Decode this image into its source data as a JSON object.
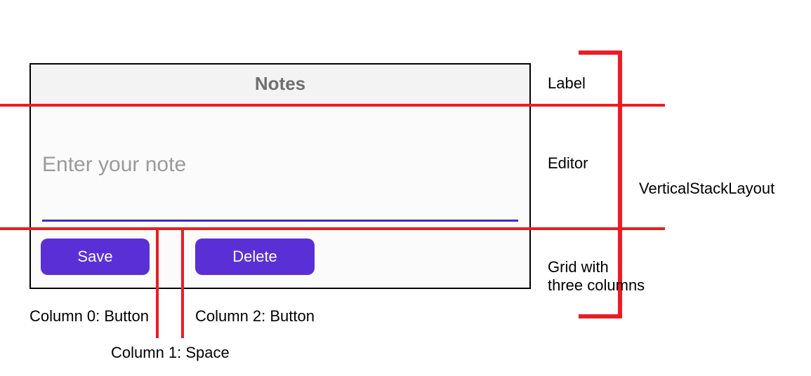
{
  "app": {
    "title": "Notes",
    "editor_placeholder": "Enter your note",
    "buttons": {
      "save": "Save",
      "delete": "Delete"
    }
  },
  "annotations": {
    "label_row": "Label",
    "editor_row": "Editor",
    "grid_row1": "Grid with",
    "grid_row2": "three columns",
    "stacklayout": "VerticalStackLayout",
    "col0": "Column 0: Button",
    "col1": "Column 1: Space",
    "col2": "Column 2: Button",
    "accent_color": "#ec1c24",
    "button_color": "#5a30d6",
    "underline_color": "#3b2bcf"
  }
}
